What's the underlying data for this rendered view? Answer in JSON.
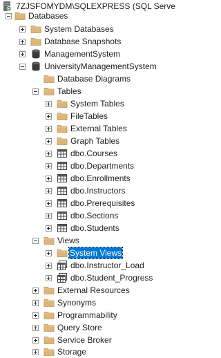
{
  "server": {
    "label": "7ZJSFOMYDM\\SQLEXPRESS (SQL Serve"
  },
  "tree": {
    "databases": "Databases",
    "system_databases": "System Databases",
    "database_snapshots": "Database Snapshots",
    "management_system": "ManagementSystem",
    "university_db": "UniversityManagementSystem",
    "database_diagrams": "Database Diagrams",
    "tables": "Tables",
    "system_tables": "System Tables",
    "file_tables": "FileTables",
    "external_tables": "External Tables",
    "graph_tables": "Graph Tables",
    "table_items": [
      "dbo.Courses",
      "dbo.Departments",
      "dbo.Enrollments",
      "dbo.Instructors",
      "dbo.Prerequisites",
      "dbo.Sections",
      "dbo.Students"
    ],
    "views": "Views",
    "system_views": "System Views",
    "view_items": [
      "dbo.Instructor_Load",
      "dbo.Student_Progress"
    ],
    "external_resources": "External Resources",
    "synonyms": "Synonyms",
    "programmability": "Programmability",
    "query_store": "Query Store",
    "service_broker": "Service Broker",
    "storage": "Storage"
  },
  "colors": {
    "selection": "#0078d7",
    "folder": "#dcb67a",
    "db_icon": "#3a3a3a",
    "server_icon": "#6a6a6a",
    "running": "#2ea043"
  }
}
